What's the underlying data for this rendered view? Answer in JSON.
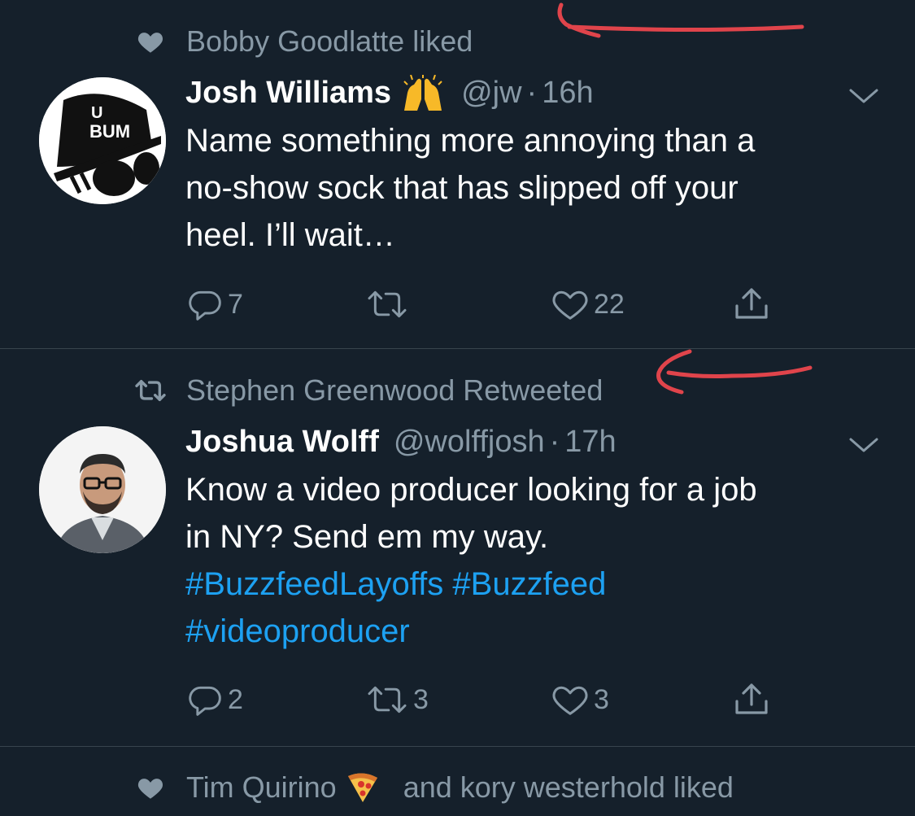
{
  "tweets": [
    {
      "context": {
        "icon": "heart-icon",
        "text": "Bobby Goodlatte liked"
      },
      "author": {
        "name": "Josh Williams",
        "emoji": "raising-hands",
        "handle": "@jw",
        "dot": "·",
        "time": "16h"
      },
      "avatar": {
        "text_top": "U",
        "text_bottom": "BUM"
      },
      "body_lines": [
        "Name something more annoying than a",
        "no-show sock that has slipped off your",
        "heel. I’ll wait…"
      ],
      "actions": {
        "reply": "7",
        "retweet": "",
        "like": "22"
      }
    },
    {
      "context": {
        "icon": "retweet-icon",
        "text": "Stephen Greenwood Retweeted"
      },
      "author": {
        "name": "Joshua Wolff",
        "handle": "@wolffjosh",
        "dot": "·",
        "time": "17h"
      },
      "body_lines": [
        "Know a video producer looking for a job",
        "in NY? Send em my way."
      ],
      "hashtag_lines": [
        [
          "#BuzzfeedLayoffs",
          "#Buzzfeed"
        ],
        [
          "#videoproducer"
        ]
      ],
      "actions": {
        "reply": "2",
        "retweet": "3",
        "like": "3"
      }
    }
  ],
  "footer_context": {
    "icon": "heart-icon",
    "name": "Tim Quirino",
    "emoji": "pizza",
    "rest": "and kory westerhold liked"
  },
  "colors": {
    "background": "#15202b",
    "secondary": "#8899a6",
    "link": "#1da1f2",
    "divider": "#38444d",
    "annotation": "#e0444b"
  }
}
